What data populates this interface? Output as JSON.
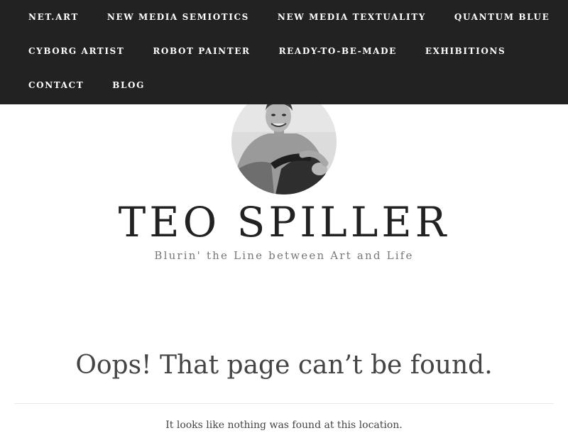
{
  "nav": {
    "items": [
      {
        "label": "NET.ART"
      },
      {
        "label": "NEW MEDIA SEMIOTICS"
      },
      {
        "label": "NEW MEDIA TEXTUALITY"
      },
      {
        "label": "QUANTUM BLUE"
      },
      {
        "label": "CYBORG ARTIST"
      },
      {
        "label": "ROBOT PAINTER"
      },
      {
        "label": "READY-TO-BE-MADE"
      },
      {
        "label": "EXHIBITIONS"
      },
      {
        "label": "CONTACT"
      },
      {
        "label": "BLOG"
      }
    ]
  },
  "header": {
    "site_title": "TEO SPILLER",
    "tagline": "Blurin' the Line between Art and Life"
  },
  "main": {
    "error_title": "Oops! That page can’t be found.",
    "error_text": "It looks like nothing was found at this location."
  },
  "colors": {
    "nav_background": "#222222",
    "nav_text": "#ffffff",
    "title_text": "#222222",
    "tagline_text": "#777777"
  }
}
